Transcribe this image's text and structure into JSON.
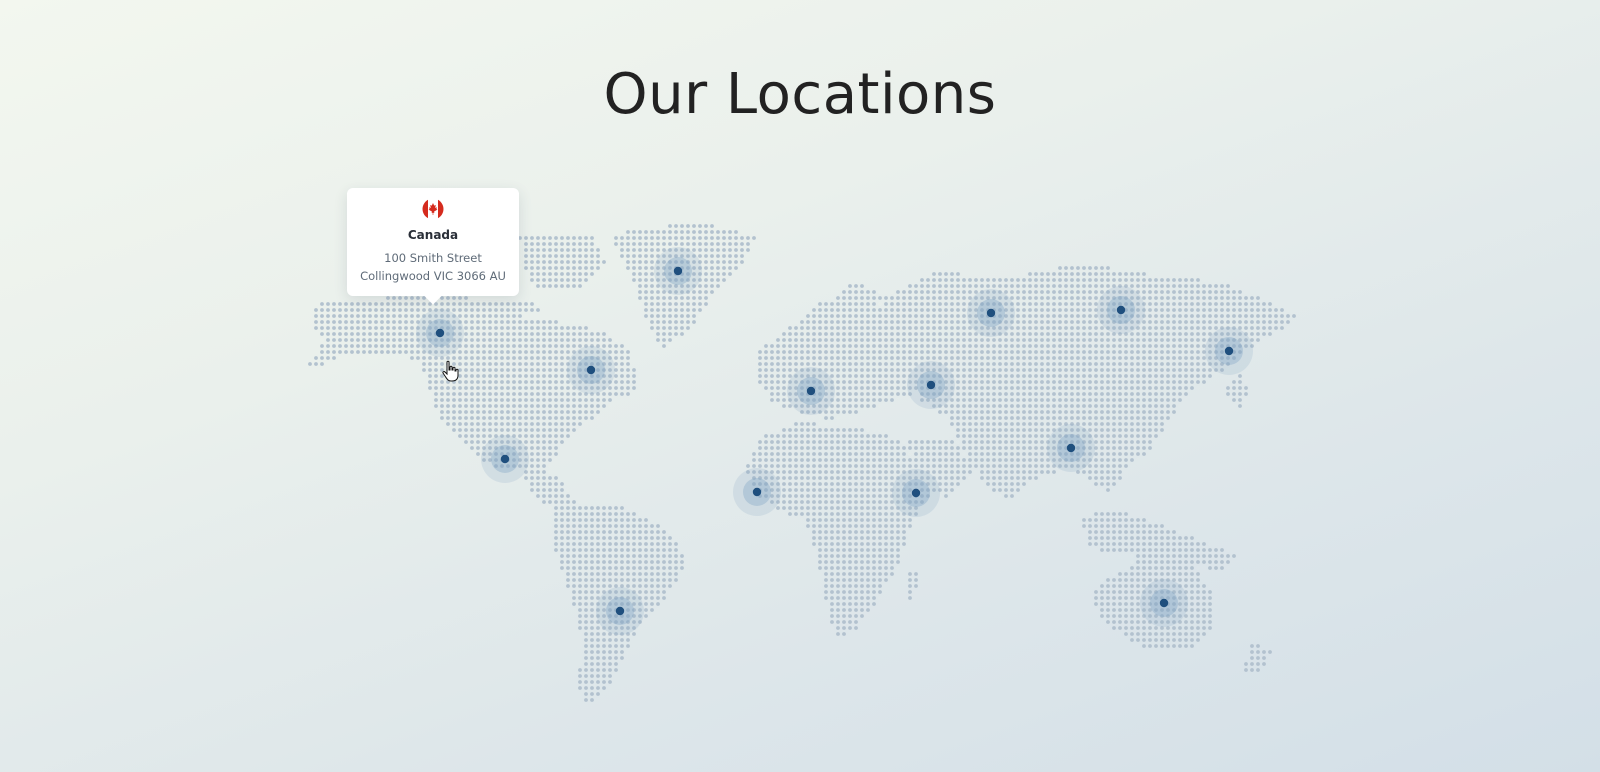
{
  "page": {
    "title": "Our Locations"
  },
  "tooltip": {
    "country": "Canada",
    "flag_icon": "canada-flag-icon",
    "address_line1": "100 Smith Street",
    "address_line2": "Collingwood VIC 3066 AU"
  },
  "colors": {
    "pin": "#1f4f7e",
    "pin_halo": "#7fa3c2",
    "map_dot": "#b3c2cf",
    "flag_red": "#d52b1e"
  }
}
